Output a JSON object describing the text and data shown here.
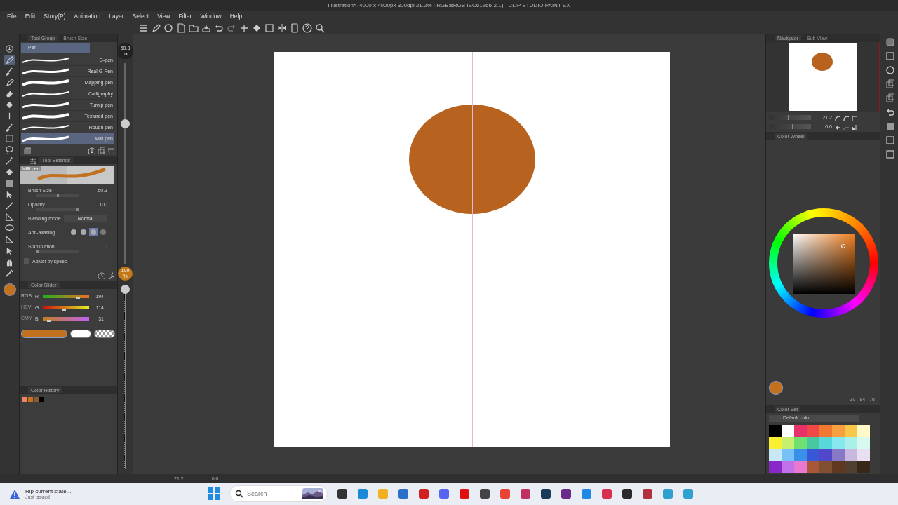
{
  "window": {
    "title": "Illustration* (4000 x 4000px 300dpi 21.2% : RGB:sRGB IEC61966-2.1) - CLIP STUDIO PAINT EX"
  },
  "menu": [
    "File",
    "Edit",
    "Story(P)",
    "Animation",
    "Layer",
    "Select",
    "View",
    "Filter",
    "Window",
    "Help"
  ],
  "tool_group": {
    "tabs": [
      {
        "label": "Tool Group",
        "selected": true
      },
      {
        "label": "Brush Size",
        "selected": false
      }
    ],
    "group": "Pen",
    "brushes": [
      {
        "name": "G-pen",
        "selected": false
      },
      {
        "name": "Real G-Pen",
        "selected": false
      },
      {
        "name": "Mapping pen",
        "selected": false
      },
      {
        "name": "Calligraphy",
        "selected": false
      },
      {
        "name": "Turnip pen",
        "selected": false
      },
      {
        "name": "Textured pen",
        "selected": false
      },
      {
        "name": "Rough pen",
        "selected": false
      },
      {
        "name": "Milli pen",
        "selected": true
      }
    ]
  },
  "size_slider": {
    "value": "50.3",
    "unit": "px",
    "level": 0.72
  },
  "opacity_slider": {
    "value": "100",
    "unit": "%",
    "level": 1.0
  },
  "tool_settings": {
    "title": "Tool Settings",
    "preview_label": "Milli pen",
    "properties": [
      {
        "kind": "slider",
        "label": "Brush Size",
        "value": "50.3",
        "level": 0.5
      },
      {
        "kind": "slider",
        "label": "Opacity",
        "value": "100",
        "level": 1.0
      },
      {
        "kind": "dropdown",
        "label": "Blending mode",
        "value": "Normal"
      },
      {
        "kind": "antialias",
        "label": "Anti-aliasing",
        "options": [
          {
            "selected": false
          },
          {
            "selected": false
          },
          {
            "selected": true
          },
          {
            "selected": false
          }
        ]
      },
      {
        "kind": "slider",
        "label": "Stabilization",
        "value": "0",
        "level": 0.0
      }
    ],
    "adjust_label": "Adjust by speed"
  },
  "color_slider": {
    "title": "Color Slider",
    "modes": [
      {
        "label": "RGB",
        "selected": true
      },
      {
        "label": "HSV",
        "selected": false
      },
      {
        "label": "CMY",
        "selected": false
      }
    ],
    "channels": [
      {
        "name": "R",
        "value": "194",
        "level": 0.76
      },
      {
        "name": "G",
        "value": "114",
        "level": 0.45
      },
      {
        "name": "B",
        "value": "31",
        "level": 0.12
      }
    ],
    "current": {
      "color": "#c2721f"
    }
  },
  "color_history": {
    "title": "Color History",
    "colors": [
      {
        "color": "#f2865a"
      },
      {
        "color": "#c2721f"
      },
      {
        "color": "#8a5a30"
      },
      {
        "color": "#000000"
      }
    ]
  },
  "navigator": {
    "tabs": [
      {
        "label": "Navigator",
        "selected": true
      },
      {
        "label": "Sub View",
        "selected": false
      }
    ],
    "sliders": [
      {
        "value": "21.2",
        "level": 0.45
      },
      {
        "value": "0.0",
        "level": 0.55
      }
    ]
  },
  "color_wheel": {
    "title": "Color Wheel",
    "values": [
      "30",
      "84",
      "76"
    ]
  },
  "color_set": {
    "title": "Color Set",
    "set_name": "Default colo",
    "colors": [
      {
        "color": "#000000"
      },
      {
        "color": "#ffffff"
      },
      {
        "color": "#e8306a"
      },
      {
        "color": "#f04848"
      },
      {
        "color": "#f07830"
      },
      {
        "color": "#f8a040"
      },
      {
        "color": "#f8c848"
      },
      {
        "color": "#fff8c8"
      },
      {
        "color": "#f8f030"
      },
      {
        "color": "#c8f070"
      },
      {
        "color": "#70e070"
      },
      {
        "color": "#48c8a0"
      },
      {
        "color": "#58d8d8"
      },
      {
        "color": "#88e8f0"
      },
      {
        "color": "#a8f0e8"
      },
      {
        "color": "#d8f8f0"
      },
      {
        "color": "#c8e8f8"
      },
      {
        "color": "#78c0f8"
      },
      {
        "color": "#3890e8"
      },
      {
        "color": "#3858d8"
      },
      {
        "color": "#5048c8"
      },
      {
        "color": "#8878c8"
      },
      {
        "color": "#c8b8e0"
      },
      {
        "color": "#e8e0f0"
      },
      {
        "color": "#8828c8"
      },
      {
        "color": "#c070e8"
      },
      {
        "color": "#e878d0"
      },
      {
        "color": "#a85838"
      },
      {
        "color": "#805030"
      },
      {
        "color": "#603820"
      },
      {
        "color": "#504030"
      },
      {
        "color": "#382818"
      }
    ]
  },
  "status": {
    "zoom": "21.2",
    "angle": "0.0"
  },
  "taskbar": {
    "notification": {
      "title": "Rip current state...",
      "subtitle": "Just issued"
    },
    "search_placeholder": "Search"
  }
}
